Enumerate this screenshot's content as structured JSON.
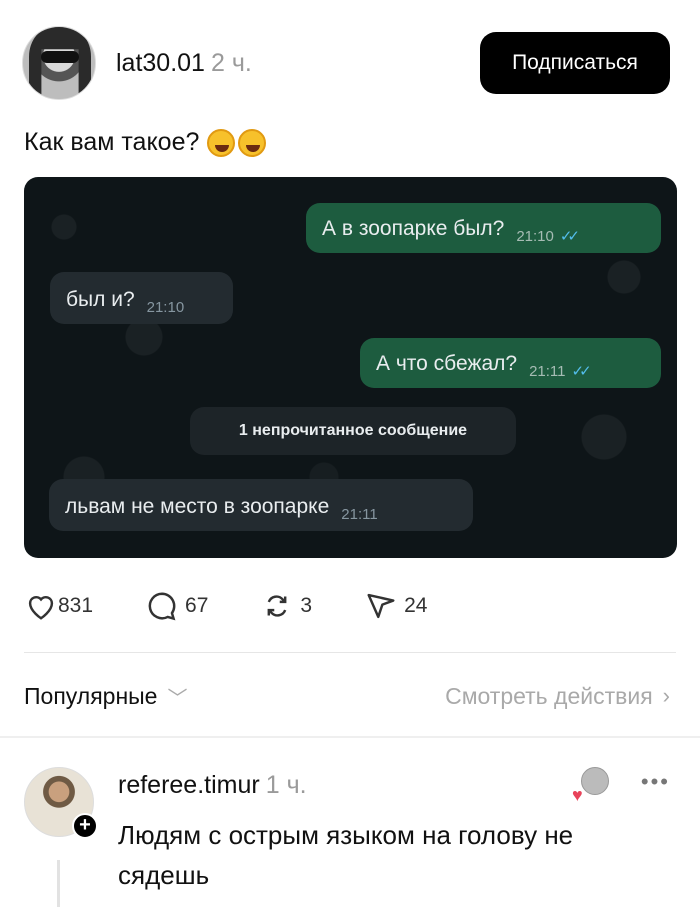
{
  "post": {
    "author": "lat30.01",
    "time": "2 ч.",
    "follow_label": "Подписаться",
    "text": "Как вам такое?"
  },
  "screenshot": {
    "messages": [
      {
        "text": "А в зоопарке был?",
        "time": "21:10",
        "direction": "out",
        "read": true
      },
      {
        "text": "был и?",
        "time": "21:10",
        "direction": "in"
      },
      {
        "text": "А что сбежал?",
        "time": "21:11",
        "direction": "out",
        "read": true
      },
      {
        "text": "львам не место в зоопарке",
        "time": "21:11",
        "direction": "in"
      }
    ],
    "unread_banner": "1 непрочитанное сообщение",
    "colors": {
      "outgoing": "#1d5c3f",
      "incoming": "#232b30",
      "ticks": "#53bdeb"
    }
  },
  "actions": {
    "likes": "831",
    "comments": "67",
    "reposts": "3",
    "shares": "24"
  },
  "sort": {
    "label": "Популярные",
    "activity_link": "Смотреть действия"
  },
  "comment": {
    "author": "referee.timur",
    "time": "1 ч.",
    "text": "Людям с  острым языком на голову не сядешь",
    "more": "•••"
  }
}
